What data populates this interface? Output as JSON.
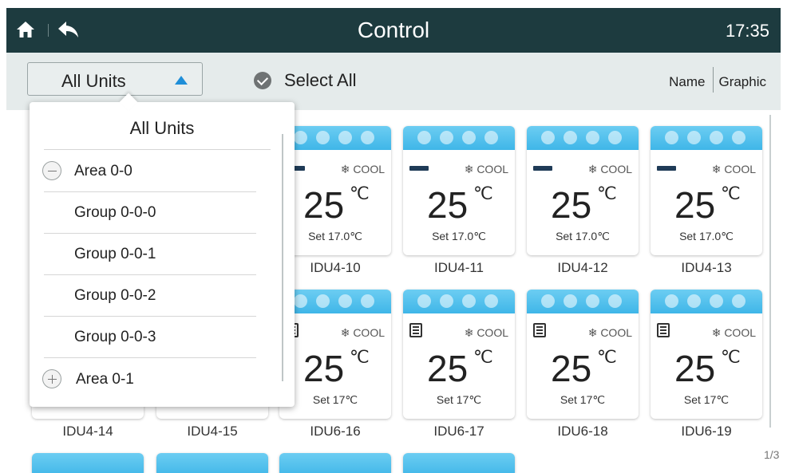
{
  "header": {
    "title": "Control",
    "time": "17:35"
  },
  "toolbar": {
    "unit_filter": "All Units",
    "select_all": "Select All",
    "view_name": "Name",
    "view_graphic": "Graphic"
  },
  "dropdown": {
    "title": "All Units",
    "items": [
      {
        "label": "Area 0-0",
        "type": "area",
        "expanded": true
      },
      {
        "label": "Group 0-0-0",
        "type": "group"
      },
      {
        "label": "Group 0-0-1",
        "type": "group"
      },
      {
        "label": "Group 0-0-2",
        "type": "group"
      },
      {
        "label": "Group 0-0-3",
        "type": "group"
      },
      {
        "label": "Area 0-1",
        "type": "area",
        "expanded": false
      }
    ]
  },
  "units_row1": [
    {
      "name": "IDU4-10",
      "mode": "❄ COOL",
      "temp": "25",
      "unit": "℃",
      "set": "Set  17.0℃",
      "fan_icon": "louver-icon"
    },
    {
      "name": "IDU4-11",
      "mode": "❄ COOL",
      "temp": "25",
      "unit": "℃",
      "set": "Set  17.0℃",
      "fan_icon": "louver-icon"
    },
    {
      "name": "IDU4-12",
      "mode": "❄ COOL",
      "temp": "25",
      "unit": "℃",
      "set": "Set  17.0℃",
      "fan_icon": "louver-icon"
    },
    {
      "name": "IDU4-13",
      "mode": "❄ COOL",
      "temp": "25",
      "unit": "℃",
      "set": "Set  17.0℃",
      "fan_icon": "louver-icon"
    }
  ],
  "units_row2": [
    {
      "name": "IDU4-14"
    },
    {
      "name": "IDU4-15"
    },
    {
      "name": "IDU6-16",
      "mode": "❄ COOL",
      "temp": "25",
      "unit": "℃",
      "set": "Set  17℃",
      "fan_icon": "grille-icon"
    },
    {
      "name": "IDU6-17",
      "mode": "❄ COOL",
      "temp": "25",
      "unit": "℃",
      "set": "Set  17℃",
      "fan_icon": "grille-icon"
    },
    {
      "name": "IDU6-18",
      "mode": "❄ COOL",
      "temp": "25",
      "unit": "℃",
      "set": "Set  17℃",
      "fan_icon": "grille-icon"
    },
    {
      "name": "IDU6-19",
      "mode": "❄ COOL",
      "temp": "25",
      "unit": "℃",
      "set": "Set  17℃",
      "fan_icon": "grille-icon"
    }
  ],
  "pagination": "1/3",
  "colors": {
    "header_bg": "#1d3b3f",
    "toolbar_bg": "#e5ebeb",
    "card_bar": "#3fb6e8",
    "accent": "#1f8ed8"
  }
}
